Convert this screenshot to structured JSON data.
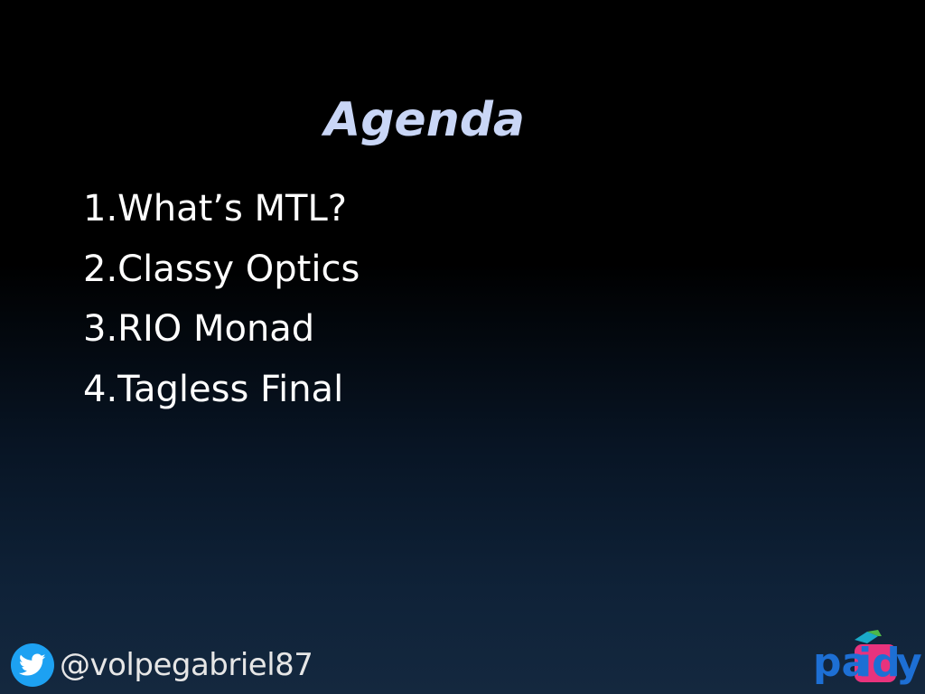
{
  "slide": {
    "title": "Agenda",
    "items": [
      "1.What’s MTL?",
      "2.Classy Optics",
      "3.RIO Monad",
      "4.Tagless Final"
    ]
  },
  "footer": {
    "twitter_icon": "twitter-bird-icon",
    "handle": "@volpegabriel87",
    "logo": {
      "text": "paidy",
      "colors": {
        "blue": "#1d6fd4",
        "pink": "#e8337d",
        "green": "#4db848",
        "teal": "#1aa9c8"
      }
    }
  },
  "colors": {
    "title": "#c9d6f6",
    "text": "#ffffff",
    "twitter": "#1da1f2"
  }
}
